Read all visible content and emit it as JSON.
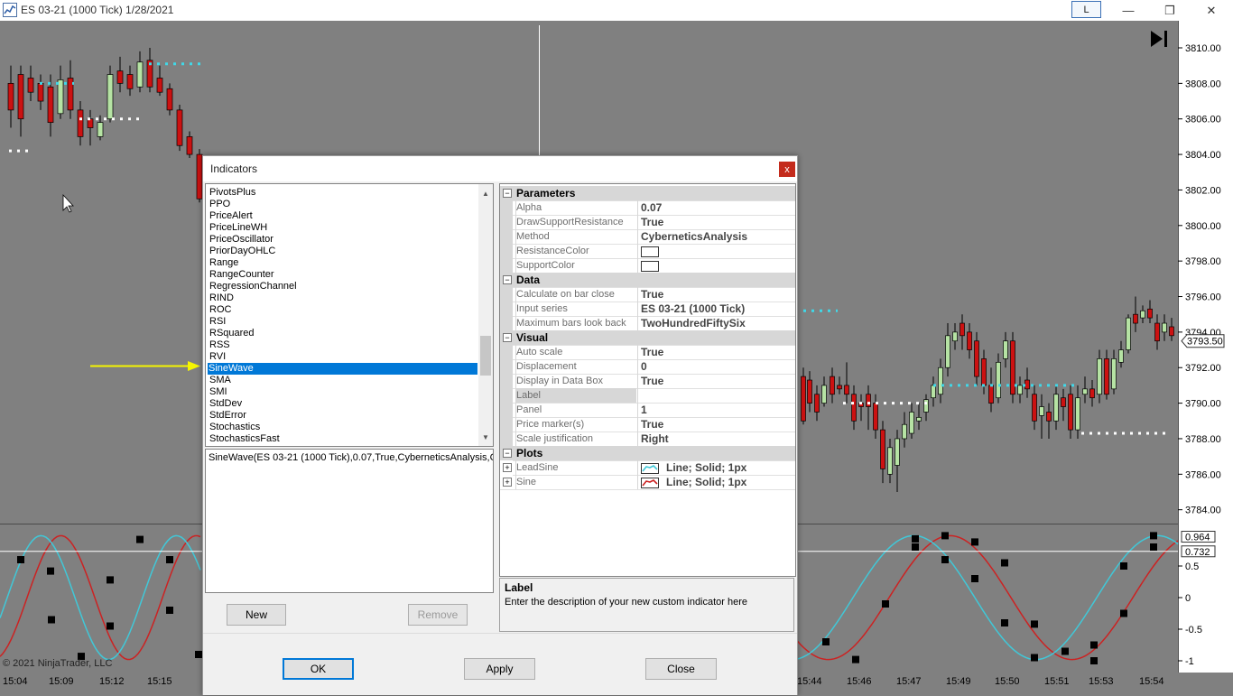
{
  "window": {
    "title": "ES 03-21 (1000 Tick)  1/28/2021",
    "l_button": "L",
    "minimize": "—",
    "restore": "❐",
    "close": "✕"
  },
  "chart": {
    "copyright": "© 2021 NinjaTrader, LLC",
    "price_ticks": [
      "3810.00",
      "3808.00",
      "3806.00",
      "3804.00",
      "3802.00",
      "3800.00",
      "3798.00",
      "3796.00",
      "3794.00",
      "3792.00",
      "3790.00",
      "3788.00",
      "3786.00",
      "3784.00"
    ],
    "current_price": "3793.50",
    "osc_ticks": [
      "0.5",
      "0",
      "-0.5",
      "-1"
    ],
    "osc_markers": [
      "0.964",
      "0.732"
    ],
    "time_labels_left": [
      "15:04",
      "15:09",
      "15:12",
      "15:15"
    ],
    "time_labels_right": [
      "15:44",
      "15:46",
      "15:47",
      "15:49",
      "15:50",
      "15:51",
      "15:53",
      "15:54"
    ],
    "colors": {
      "bull": "#b6e3a4",
      "bear": "#cc1111",
      "cyan_line": "#40c8d8",
      "red_line": "#cc2222",
      "bg": "#808080"
    }
  },
  "dialog": {
    "title": "Indicators",
    "close_label": "x",
    "indicators": [
      "PivotsPlus",
      "PPO",
      "PriceAlert",
      "PriceLineWH",
      "PriceOscillator",
      "PriorDayOHLC",
      "Range",
      "RangeCounter",
      "RegressionChannel",
      "RIND",
      "ROC",
      "RSI",
      "RSquared",
      "RSS",
      "RVI",
      "SineWave",
      "SMA",
      "SMI",
      "StdDev",
      "StdError",
      "Stochastics",
      "StochasticsFast"
    ],
    "selected": "SineWave",
    "expression": "SineWave(ES 03-21 (1000 Tick),0.07,True,CyberneticsAnalysis,Cc",
    "new_label": "New",
    "remove_label": "Remove",
    "ok_label": "OK",
    "apply_label": "Apply",
    "close_btn_label": "Close",
    "categories": {
      "parameters": "Parameters",
      "data": "Data",
      "visual": "Visual",
      "plots": "Plots"
    },
    "params": [
      {
        "name": "Alpha",
        "value": "0.07"
      },
      {
        "name": "DrawSupportResistance",
        "value": "True"
      },
      {
        "name": "Method",
        "value": "CyberneticsAnalysis"
      },
      {
        "name": "ResistanceColor",
        "value": ""
      },
      {
        "name": "SupportColor",
        "value": ""
      }
    ],
    "data_props": [
      {
        "name": "Calculate on bar close",
        "value": "True"
      },
      {
        "name": "Input series",
        "value": "ES 03-21 (1000 Tick)"
      },
      {
        "name": "Maximum bars look back",
        "value": "TwoHundredFiftySix"
      }
    ],
    "visual_props": [
      {
        "name": "Auto scale",
        "value": "True"
      },
      {
        "name": "Displacement",
        "value": "0"
      },
      {
        "name": "Display in Data Box",
        "value": "True"
      },
      {
        "name": "Label",
        "value": ""
      },
      {
        "name": "Panel",
        "value": "1"
      },
      {
        "name": "Price marker(s)",
        "value": "True"
      },
      {
        "name": "Scale justification",
        "value": "Right"
      }
    ],
    "plots": [
      {
        "name": "LeadSine",
        "value": "Line;  Solid;  1px",
        "color": "#40c8d8"
      },
      {
        "name": "Sine",
        "value": "Line;  Solid;  1px",
        "color": "#cc2222"
      }
    ],
    "description_title": "Label",
    "description_text": "Enter the description of your new custom indicator here"
  }
}
